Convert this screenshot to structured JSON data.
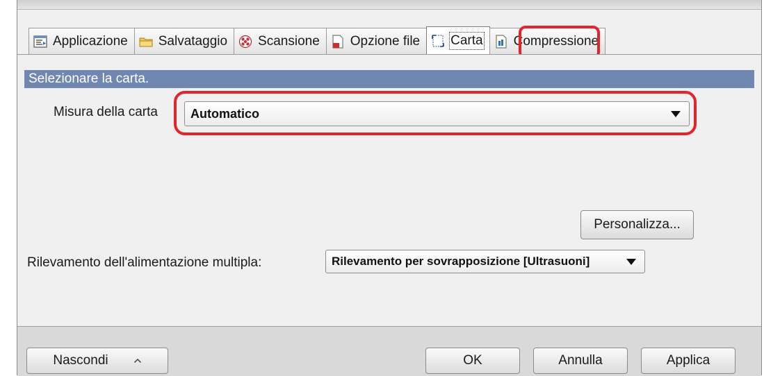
{
  "tabs": [
    {
      "label": "Applicazione",
      "icon": "application-icon"
    },
    {
      "label": "Salvataggio",
      "icon": "folder-icon"
    },
    {
      "label": "Scansione",
      "icon": "scan-icon"
    },
    {
      "label": "Opzione file",
      "icon": "file-icon"
    },
    {
      "label": "Carta",
      "icon": "paper-icon",
      "active": true
    },
    {
      "label": "Compressione",
      "icon": "compression-icon"
    }
  ],
  "panel": {
    "header": "Selezionare la carta.",
    "paper_size_label": "Misura della carta",
    "paper_size_value": "Automatico",
    "customize_button": "Personalizza...",
    "multifeed_label": "Rilevamento dell'alimentazione multipla:",
    "multifeed_value": "Rilevamento per sovrapposizione [Ultrasuoni]"
  },
  "footer": {
    "hide_button": "Nascondi",
    "ok_button": "OK",
    "cancel_button": "Annulla",
    "apply_button": "Applica"
  },
  "colors": {
    "highlight": "#e2252b",
    "section_header": "#6f87b1"
  }
}
